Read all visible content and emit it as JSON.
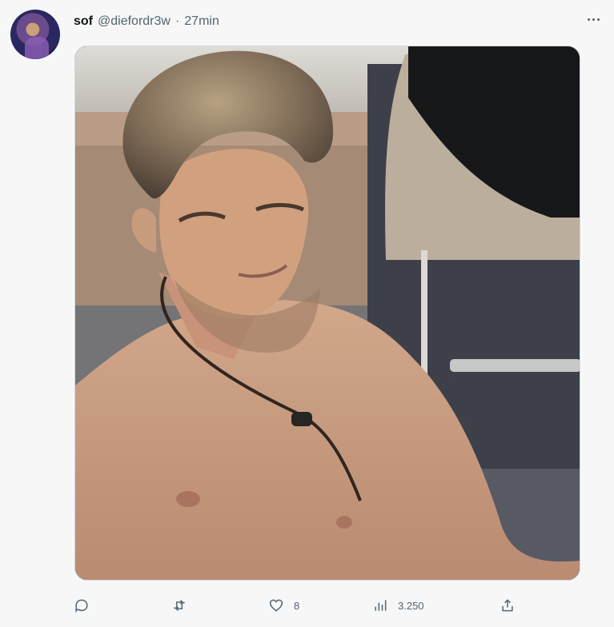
{
  "tweet": {
    "author": {
      "name": "sof",
      "handle": "@diefordr3w",
      "separator": "·",
      "time": "27min"
    },
    "stats": {
      "likes": "8",
      "views": "3.250"
    },
    "icons": {
      "more": "more-icon",
      "reply": "reply-icon",
      "retweet": "retweet-icon",
      "like": "heart-icon",
      "views": "views-icon",
      "share": "share-icon"
    }
  }
}
